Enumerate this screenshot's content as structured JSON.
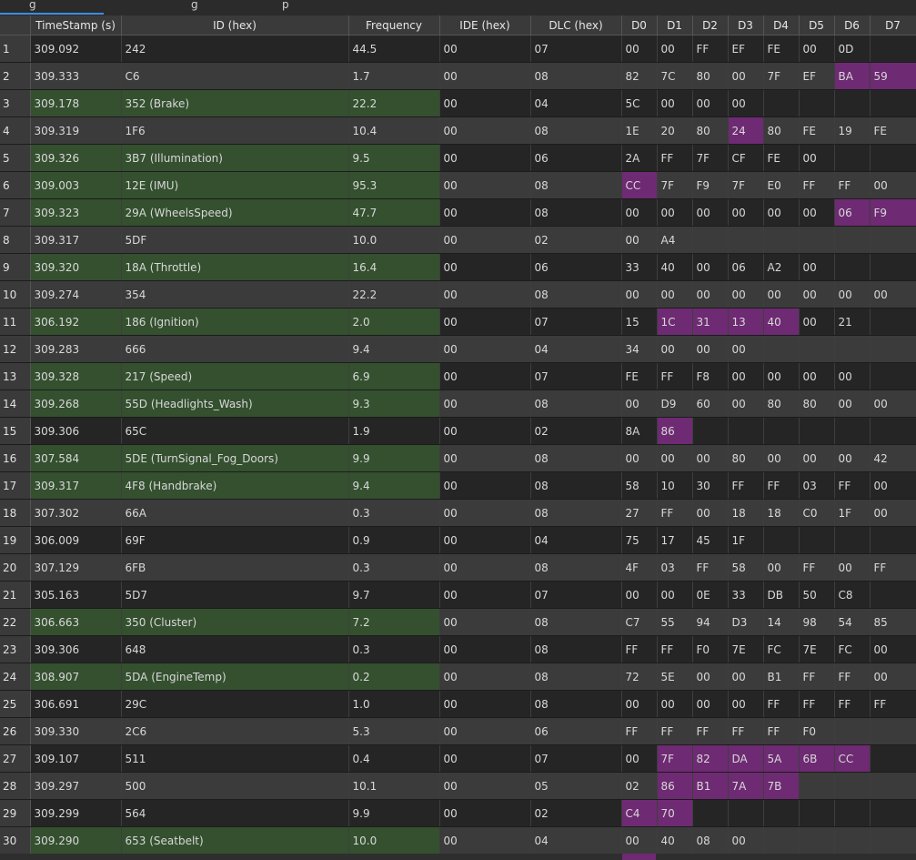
{
  "tabs": [
    {
      "label": "g"
    },
    {
      "label": "g"
    },
    {
      "label": "p"
    }
  ],
  "columns": [
    "TimeStamp (s)",
    "ID (hex)",
    "Frequency",
    "IDE (hex)",
    "DLC (hex)",
    "D0",
    "D1",
    "D2",
    "D3",
    "D4",
    "D5",
    "D6",
    "D7"
  ],
  "colors": {
    "known_id_bg": "#34502f",
    "changed_byte_bg": "#6e2a72",
    "row_dark": "#252525",
    "row_light": "#3b3b3b",
    "header_bg": "#3a3a3a",
    "tab_accent": "#3d8ee6"
  },
  "rows": [
    {
      "n": "1",
      "ts": "309.092",
      "id": "242",
      "freq": "44.5",
      "ide": "00",
      "dlc": "07",
      "d": [
        "00",
        "00",
        "FF",
        "EF",
        "FE",
        "00",
        "0D",
        ""
      ],
      "known": false,
      "chg": []
    },
    {
      "n": "2",
      "ts": "309.333",
      "id": "C6",
      "freq": "1.7",
      "ide": "00",
      "dlc": "08",
      "d": [
        "82",
        "7C",
        "80",
        "00",
        "7F",
        "EF",
        "BA",
        "59"
      ],
      "known": false,
      "chg": [
        6,
        7
      ]
    },
    {
      "n": "3",
      "ts": "309.178",
      "id": "352 (Brake)",
      "freq": "22.2",
      "ide": "00",
      "dlc": "04",
      "d": [
        "5C",
        "00",
        "00",
        "00",
        "",
        "",
        "",
        ""
      ],
      "known": true,
      "chg": []
    },
    {
      "n": "4",
      "ts": "309.319",
      "id": "1F6",
      "freq": "10.4",
      "ide": "00",
      "dlc": "08",
      "d": [
        "1E",
        "20",
        "80",
        "24",
        "80",
        "FE",
        "19",
        "FE"
      ],
      "known": false,
      "chg": [
        3
      ]
    },
    {
      "n": "5",
      "ts": "309.326",
      "id": "3B7 (Illumination)",
      "freq": "9.5",
      "ide": "00",
      "dlc": "06",
      "d": [
        "2A",
        "FF",
        "7F",
        "CF",
        "FE",
        "00",
        "",
        ""
      ],
      "known": true,
      "chg": []
    },
    {
      "n": "6",
      "ts": "309.003",
      "id": "12E (IMU)",
      "freq": "95.3",
      "ide": "00",
      "dlc": "08",
      "d": [
        "CC",
        "7F",
        "F9",
        "7F",
        "E0",
        "FF",
        "FF",
        "00"
      ],
      "known": true,
      "chg": [
        0
      ]
    },
    {
      "n": "7",
      "ts": "309.323",
      "id": "29A (WheelsSpeed)",
      "freq": "47.7",
      "ide": "00",
      "dlc": "08",
      "d": [
        "00",
        "00",
        "00",
        "00",
        "00",
        "00",
        "06",
        "F9"
      ],
      "known": true,
      "chg": [
        6,
        7
      ]
    },
    {
      "n": "8",
      "ts": "309.317",
      "id": "5DF",
      "freq": "10.0",
      "ide": "00",
      "dlc": "02",
      "d": [
        "00",
        "A4",
        "",
        "",
        "",
        "",
        "",
        ""
      ],
      "known": false,
      "chg": []
    },
    {
      "n": "9",
      "ts": "309.320",
      "id": "18A (Throttle)",
      "freq": "16.4",
      "ide": "00",
      "dlc": "06",
      "d": [
        "33",
        "40",
        "00",
        "06",
        "A2",
        "00",
        "",
        ""
      ],
      "known": true,
      "chg": []
    },
    {
      "n": "10",
      "ts": "309.274",
      "id": "354",
      "freq": "22.2",
      "ide": "00",
      "dlc": "08",
      "d": [
        "00",
        "00",
        "00",
        "00",
        "00",
        "00",
        "00",
        "00"
      ],
      "known": false,
      "chg": []
    },
    {
      "n": "11",
      "ts": "306.192",
      "id": "186 (Ignition)",
      "freq": "2.0",
      "ide": "00",
      "dlc": "07",
      "d": [
        "15",
        "1C",
        "31",
        "13",
        "40",
        "00",
        "21",
        ""
      ],
      "known": true,
      "chg": [
        1,
        2,
        3,
        4
      ]
    },
    {
      "n": "12",
      "ts": "309.283",
      "id": "666",
      "freq": "9.4",
      "ide": "00",
      "dlc": "04",
      "d": [
        "34",
        "00",
        "00",
        "00",
        "",
        "",
        "",
        ""
      ],
      "known": false,
      "chg": []
    },
    {
      "n": "13",
      "ts": "309.328",
      "id": "217 (Speed)",
      "freq": "6.9",
      "ide": "00",
      "dlc": "07",
      "d": [
        "FE",
        "FF",
        "F8",
        "00",
        "00",
        "00",
        "00",
        ""
      ],
      "known": true,
      "chg": []
    },
    {
      "n": "14",
      "ts": "309.268",
      "id": "55D (Headlights_Wash)",
      "freq": "9.3",
      "ide": "00",
      "dlc": "08",
      "d": [
        "00",
        "D9",
        "60",
        "00",
        "80",
        "80",
        "00",
        "00"
      ],
      "known": true,
      "chg": []
    },
    {
      "n": "15",
      "ts": "309.306",
      "id": "65C",
      "freq": "1.9",
      "ide": "00",
      "dlc": "02",
      "d": [
        "8A",
        "86",
        "",
        "",
        "",
        "",
        "",
        ""
      ],
      "known": false,
      "chg": [
        1
      ]
    },
    {
      "n": "16",
      "ts": "307.584",
      "id": "5DE (TurnSignal_Fog_Doors)",
      "freq": "9.9",
      "ide": "00",
      "dlc": "08",
      "d": [
        "00",
        "00",
        "00",
        "80",
        "00",
        "00",
        "00",
        "42"
      ],
      "known": true,
      "chg": []
    },
    {
      "n": "17",
      "ts": "309.317",
      "id": "4F8 (Handbrake)",
      "freq": "9.4",
      "ide": "00",
      "dlc": "08",
      "d": [
        "58",
        "10",
        "30",
        "FF",
        "FF",
        "03",
        "FF",
        "00"
      ],
      "known": true,
      "chg": []
    },
    {
      "n": "18",
      "ts": "307.302",
      "id": "66A",
      "freq": "0.3",
      "ide": "00",
      "dlc": "08",
      "d": [
        "27",
        "FF",
        "00",
        "18",
        "18",
        "C0",
        "1F",
        "00"
      ],
      "known": false,
      "chg": []
    },
    {
      "n": "19",
      "ts": "306.009",
      "id": "69F",
      "freq": "0.9",
      "ide": "00",
      "dlc": "04",
      "d": [
        "75",
        "17",
        "45",
        "1F",
        "",
        "",
        "",
        ""
      ],
      "known": false,
      "chg": []
    },
    {
      "n": "20",
      "ts": "307.129",
      "id": "6FB",
      "freq": "0.3",
      "ide": "00",
      "dlc": "08",
      "d": [
        "4F",
        "03",
        "FF",
        "58",
        "00",
        "FF",
        "00",
        "FF"
      ],
      "known": false,
      "chg": []
    },
    {
      "n": "21",
      "ts": "305.163",
      "id": "5D7",
      "freq": "9.7",
      "ide": "00",
      "dlc": "07",
      "d": [
        "00",
        "00",
        "0E",
        "33",
        "DB",
        "50",
        "C8",
        ""
      ],
      "known": false,
      "chg": []
    },
    {
      "n": "22",
      "ts": "306.663",
      "id": "350 (Cluster)",
      "freq": "7.2",
      "ide": "00",
      "dlc": "08",
      "d": [
        "C7",
        "55",
        "94",
        "D3",
        "14",
        "98",
        "54",
        "85"
      ],
      "known": true,
      "chg": []
    },
    {
      "n": "23",
      "ts": "309.306",
      "id": "648",
      "freq": "0.3",
      "ide": "00",
      "dlc": "08",
      "d": [
        "FF",
        "FF",
        "F0",
        "7E",
        "FC",
        "7E",
        "FC",
        "00"
      ],
      "known": false,
      "chg": []
    },
    {
      "n": "24",
      "ts": "308.907",
      "id": "5DA (EngineTemp)",
      "freq": "0.2",
      "ide": "00",
      "dlc": "08",
      "d": [
        "72",
        "5E",
        "00",
        "00",
        "B1",
        "FF",
        "FF",
        "00"
      ],
      "known": true,
      "chg": []
    },
    {
      "n": "25",
      "ts": "306.691",
      "id": "29C",
      "freq": "1.0",
      "ide": "00",
      "dlc": "08",
      "d": [
        "00",
        "00",
        "00",
        "00",
        "FF",
        "FF",
        "FF",
        "FF"
      ],
      "known": false,
      "chg": []
    },
    {
      "n": "26",
      "ts": "309.330",
      "id": "2C6",
      "freq": "5.3",
      "ide": "00",
      "dlc": "06",
      "d": [
        "FF",
        "FF",
        "FF",
        "FF",
        "FF",
        "F0",
        "",
        ""
      ],
      "known": false,
      "chg": []
    },
    {
      "n": "27",
      "ts": "309.107",
      "id": "511",
      "freq": "0.4",
      "ide": "00",
      "dlc": "07",
      "d": [
        "00",
        "7F",
        "82",
        "DA",
        "5A",
        "6B",
        "CC",
        ""
      ],
      "known": false,
      "chg": [
        1,
        2,
        3,
        4,
        5,
        6
      ]
    },
    {
      "n": "28",
      "ts": "309.297",
      "id": "500",
      "freq": "10.1",
      "ide": "00",
      "dlc": "05",
      "d": [
        "02",
        "86",
        "B1",
        "7A",
        "7B",
        "",
        "",
        ""
      ],
      "known": false,
      "chg": [
        1,
        2,
        3,
        4
      ]
    },
    {
      "n": "29",
      "ts": "309.299",
      "id": "564",
      "freq": "9.9",
      "ide": "00",
      "dlc": "02",
      "d": [
        "C4",
        "70",
        "",
        "",
        "",
        "",
        "",
        ""
      ],
      "known": false,
      "chg": [
        0,
        1
      ]
    },
    {
      "n": "30",
      "ts": "309.290",
      "id": "653 (Seatbelt)",
      "freq": "10.0",
      "ide": "00",
      "dlc": "04",
      "d": [
        "00",
        "40",
        "08",
        "00",
        "",
        "",
        "",
        ""
      ],
      "known": true,
      "chg": []
    }
  ]
}
